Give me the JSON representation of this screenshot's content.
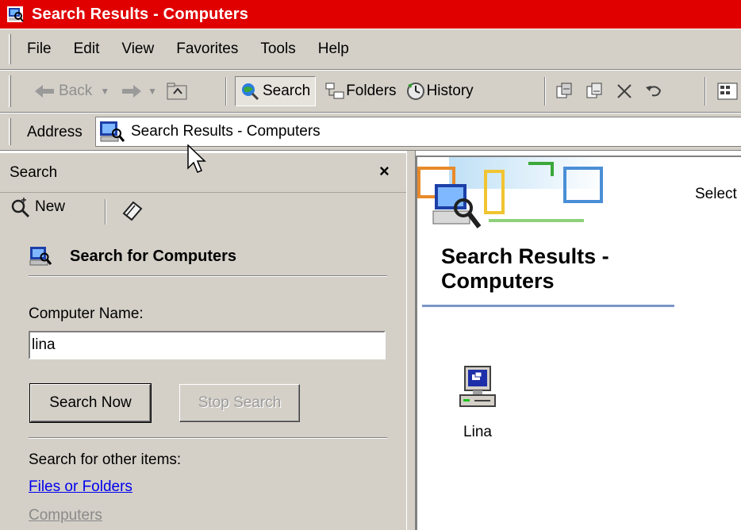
{
  "window": {
    "title": "Search Results - Computers"
  },
  "menubar": {
    "items": [
      "File",
      "Edit",
      "View",
      "Favorites",
      "Tools",
      "Help"
    ]
  },
  "toolbar": {
    "back": "Back",
    "search": "Search",
    "folders": "Folders",
    "history": "History"
  },
  "address": {
    "label": "Address",
    "value": "Search Results - Computers"
  },
  "search_pane": {
    "title": "Search",
    "close": "×",
    "new_label": "New",
    "section_title": "Search for Computers",
    "field_label": "Computer Name:",
    "field_value": "lina",
    "search_now": "Search Now",
    "stop_search": "Stop Search",
    "other_label": "Search for other items:",
    "link_files": "Files or Folders",
    "link_computers": "Computers"
  },
  "results": {
    "select_hint": "Select",
    "title": "Search Results - Computers",
    "items": [
      {
        "label": "Lina",
        "icon": "computer-icon"
      }
    ]
  },
  "colors": {
    "titlebar": "#e00000",
    "chrome": "#d4d0c8",
    "link": "#0000ee",
    "rule": "#7a96c8"
  }
}
